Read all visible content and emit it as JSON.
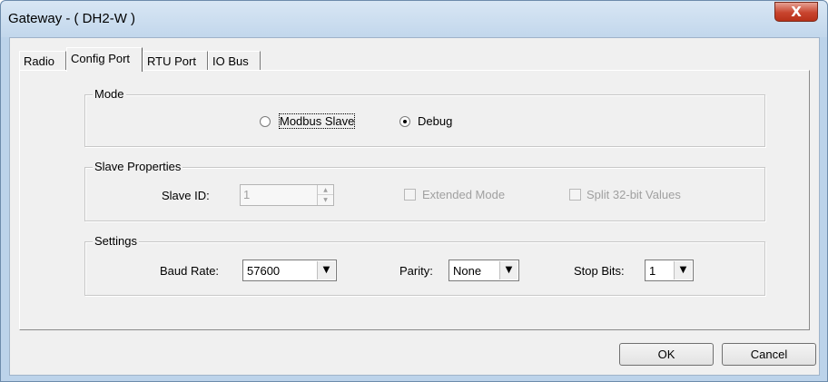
{
  "window": {
    "title": "Gateway - ( DH2-W )",
    "close_symbol": "X"
  },
  "tabs": [
    {
      "label": "Radio",
      "active": false
    },
    {
      "label": "Config Port",
      "active": true
    },
    {
      "label": "RTU Port",
      "active": false
    },
    {
      "label": "IO Bus",
      "active": false
    }
  ],
  "mode": {
    "label": "Mode",
    "options": [
      {
        "label": "Modbus Slave",
        "checked": false
      },
      {
        "label": "Debug",
        "checked": true
      }
    ]
  },
  "slave_properties": {
    "label": "Slave Properties",
    "slave_id_label": "Slave ID:",
    "slave_id_value": "1",
    "extended_mode_label": "Extended Mode",
    "split_32bit_label": "Split 32-bit Values"
  },
  "settings": {
    "label": "Settings",
    "baud_rate_label": "Baud Rate:",
    "baud_rate_value": "57600",
    "parity_label": "Parity:",
    "parity_value": "None",
    "stop_bits_label": "Stop Bits:",
    "stop_bits_value": "1"
  },
  "buttons": {
    "ok": "OK",
    "cancel": "Cancel"
  },
  "icons": {
    "close": "close-icon",
    "dropdown": "chevron-down-icon",
    "spin_up": "arrow-up-icon",
    "spin_down": "arrow-down-icon"
  }
}
